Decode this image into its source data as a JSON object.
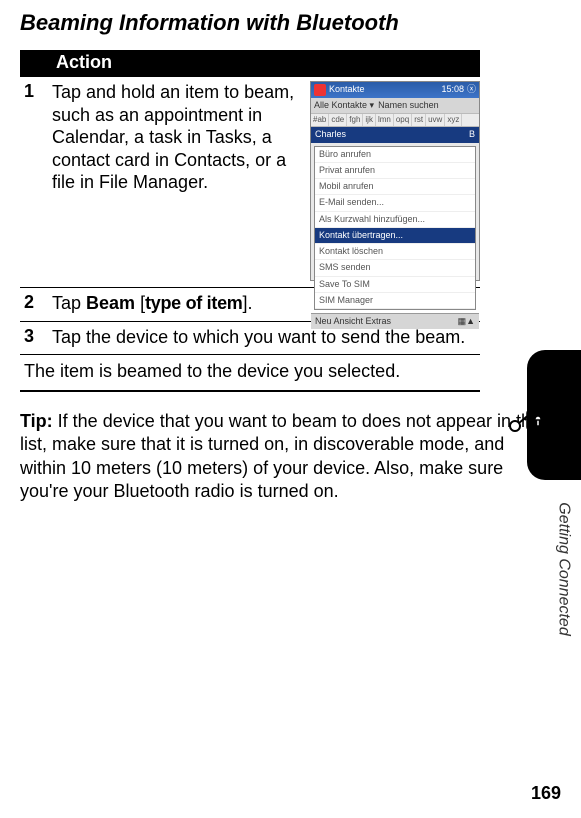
{
  "title": "Beaming Information with Bluetooth",
  "action_header": "Action",
  "steps": {
    "s1": {
      "num": "1",
      "text": "Tap and hold an item to beam, such as an appointment in Calendar, a task in Tasks, a contact card in Contacts, or a file in File Manager."
    },
    "s2": {
      "num": "2",
      "prefix": "Tap ",
      "beam": "Beam",
      "bracket_open": " [",
      "type": "type of item",
      "bracket_close": "]."
    },
    "s3": {
      "num": "3",
      "text": "Tap the device to which you want to send the beam."
    }
  },
  "result_line": "The item is beamed to the device you selected.",
  "tip": {
    "label": "Tip: ",
    "body": "If the device that you want to beam to does not appear in the list, make sure that it is turned on, in discoverable mode, and within 10 meters (10 meters) of your device. Also, make sure you're your Bluetooth radio is turned on."
  },
  "screenshot": {
    "title": "Kontakte",
    "time": "15:08",
    "toolbar_left": "Alle Kontakte ▾",
    "toolbar_right": "Namen suchen",
    "tabs": [
      "#ab",
      "cde",
      "fgh",
      "ijk",
      "lmn",
      "opq",
      "rst",
      "uvw",
      "xyz"
    ],
    "name_left": "Charles",
    "name_right": "B",
    "menu": [
      "Büro anrufen",
      "Privat anrufen",
      "Mobil anrufen",
      "E-Mail senden...",
      "Als Kurzwahl hinzufügen...",
      "Kontakt übertragen...",
      "Kontakt löschen",
      "SMS senden",
      "Save To SIM",
      "SIM Manager"
    ],
    "menu_highlight_index": 5,
    "status_left": "Neu Ansicht Extras",
    "status_right": "▦▲"
  },
  "side_label": "Getting Connected",
  "page_number": "169"
}
